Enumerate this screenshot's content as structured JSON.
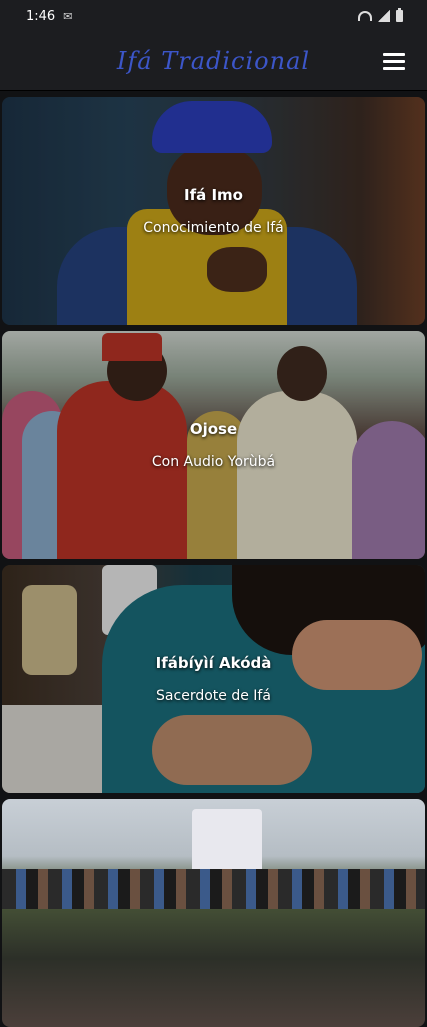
{
  "status_bar": {
    "time": "1:46",
    "icons": [
      "mail-icon",
      "wifi-icon",
      "signal-icon",
      "battery-icon"
    ]
  },
  "app_bar": {
    "title": "Ifá Tradicional",
    "title_color": "#3c56c9",
    "menu_icon": "hamburger-menu-icon"
  },
  "cards": [
    {
      "title": "Ifá Imo",
      "subtitle": "Conocimiento de Ifá"
    },
    {
      "title": "Ojose",
      "subtitle": "Con Audio Yorùbá"
    },
    {
      "title": "Ifábíyìí Akódà",
      "subtitle": "Sacerdote de Ifá"
    },
    {
      "title": "",
      "subtitle": ""
    }
  ],
  "colors": {
    "background": "#111214",
    "bar": "#1c1d20"
  }
}
